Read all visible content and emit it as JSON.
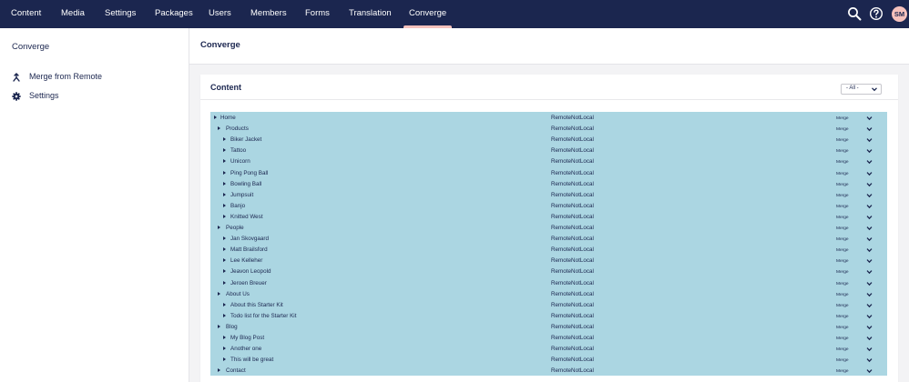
{
  "topnav": {
    "items": [
      {
        "label": "Content",
        "name": "nav-content",
        "active": false
      },
      {
        "label": "Media",
        "name": "nav-media",
        "active": false
      },
      {
        "label": "Settings",
        "name": "nav-settings",
        "active": false
      },
      {
        "label": "Packages",
        "name": "nav-packages",
        "active": false
      },
      {
        "label": "Users",
        "name": "nav-users",
        "active": false
      },
      {
        "label": "Members",
        "name": "nav-members",
        "active": false
      },
      {
        "label": "Forms",
        "name": "nav-forms",
        "active": false
      },
      {
        "label": "Translation",
        "name": "nav-translation",
        "active": false
      },
      {
        "label": "Converge",
        "name": "nav-converge",
        "active": true
      }
    ],
    "search_icon": "search-icon",
    "help_icon": "help-icon",
    "avatar_initials": "SM"
  },
  "sidebar": {
    "title": "Converge",
    "items": [
      {
        "label": "Merge from Remote",
        "icon": "merge-icon"
      },
      {
        "label": "Settings",
        "icon": "gear-icon"
      }
    ]
  },
  "main": {
    "title": "Converge",
    "panel": {
      "title": "Content",
      "filter_value": "- All -"
    }
  },
  "tree": {
    "rows": [
      {
        "name": "Home",
        "level": 0,
        "status": "RemoteNotLocal",
        "action": "Merge"
      },
      {
        "name": "Products",
        "level": 1,
        "status": "RemoteNotLocal",
        "action": "Merge"
      },
      {
        "name": "Biker Jacket",
        "level": 2,
        "status": "RemoteNotLocal",
        "action": "Merge"
      },
      {
        "name": "Tattoo",
        "level": 2,
        "status": "RemoteNotLocal",
        "action": "Merge"
      },
      {
        "name": "Unicorn",
        "level": 2,
        "status": "RemoteNotLocal",
        "action": "Merge"
      },
      {
        "name": "Ping Pong Ball",
        "level": 2,
        "status": "RemoteNotLocal",
        "action": "Merge"
      },
      {
        "name": "Bowling Ball",
        "level": 2,
        "status": "RemoteNotLocal",
        "action": "Merge"
      },
      {
        "name": "Jumpsuit",
        "level": 2,
        "status": "RemoteNotLocal",
        "action": "Merge"
      },
      {
        "name": "Banjo",
        "level": 2,
        "status": "RemoteNotLocal",
        "action": "Merge"
      },
      {
        "name": "Knitted West",
        "level": 2,
        "status": "RemoteNotLocal",
        "action": "Merge"
      },
      {
        "name": "People",
        "level": 1,
        "status": "RemoteNotLocal",
        "action": "Merge"
      },
      {
        "name": "Jan Skovgaard",
        "level": 2,
        "status": "RemoteNotLocal",
        "action": "Merge"
      },
      {
        "name": "Matt Brailsford",
        "level": 2,
        "status": "RemoteNotLocal",
        "action": "Merge"
      },
      {
        "name": "Lee Kelleher",
        "level": 2,
        "status": "RemoteNotLocal",
        "action": "Merge"
      },
      {
        "name": "Jeavon Leopold",
        "level": 2,
        "status": "RemoteNotLocal",
        "action": "Merge"
      },
      {
        "name": "Jeroen Breuer",
        "level": 2,
        "status": "RemoteNotLocal",
        "action": "Merge"
      },
      {
        "name": "About Us",
        "level": 1,
        "status": "RemoteNotLocal",
        "action": "Merge"
      },
      {
        "name": "About this Starter Kit",
        "level": 2,
        "status": "RemoteNotLocal",
        "action": "Merge"
      },
      {
        "name": "Todo list for the Starter Kit",
        "level": 2,
        "status": "RemoteNotLocal",
        "action": "Merge"
      },
      {
        "name": "Blog",
        "level": 1,
        "status": "RemoteNotLocal",
        "action": "Merge"
      },
      {
        "name": "My Blog Post",
        "level": 2,
        "status": "RemoteNotLocal",
        "action": "Merge"
      },
      {
        "name": "Another one",
        "level": 2,
        "status": "RemoteNotLocal",
        "action": "Merge"
      },
      {
        "name": "This will be great",
        "level": 2,
        "status": "RemoteNotLocal",
        "action": "Merge"
      },
      {
        "name": "Contact",
        "level": 1,
        "status": "RemoteNotLocal",
        "action": "Merge"
      }
    ]
  },
  "colors": {
    "topbar": "#1b264f",
    "accent": "#f5c1bc",
    "row_highlight": "#abd6e2",
    "text": "#1b264f"
  }
}
